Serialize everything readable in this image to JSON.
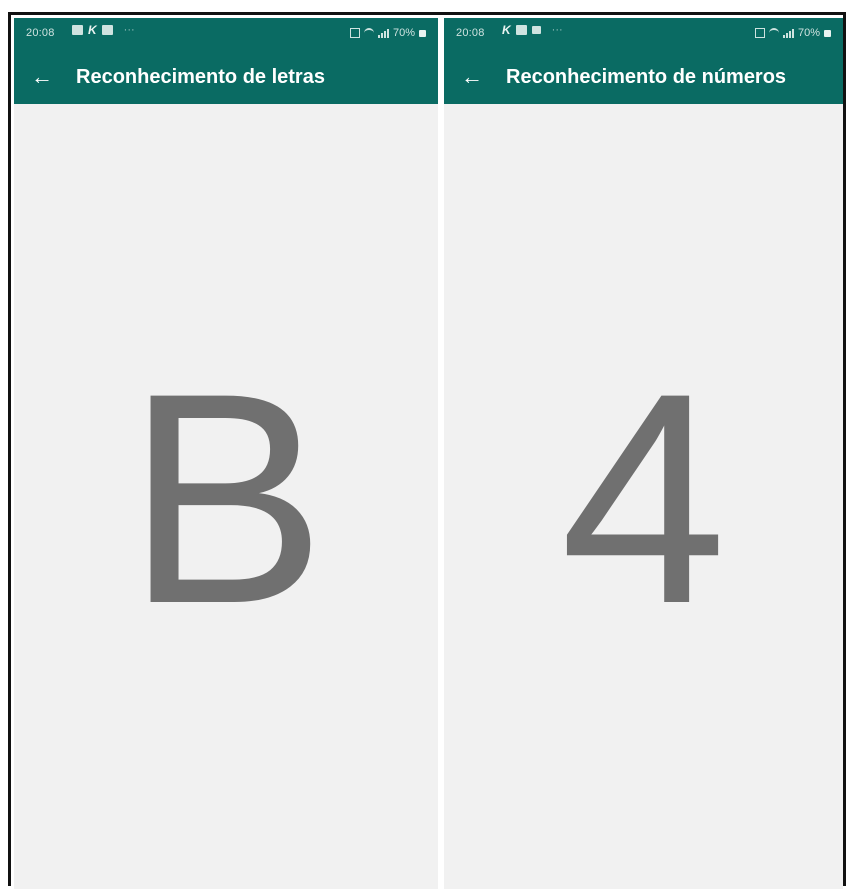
{
  "colors": {
    "app_bar": "#0a6b63",
    "background": "#f1f1f1",
    "glyph": "#707070"
  },
  "screens": [
    {
      "status": {
        "time": "20:08",
        "battery": "70%"
      },
      "title": "Reconhecimento de letras",
      "back_icon": "arrow-left-icon",
      "character": "B"
    },
    {
      "status": {
        "time": "20:08",
        "battery": "70%"
      },
      "title": "Reconhecimento de números",
      "back_icon": "arrow-left-icon",
      "character": "4"
    }
  ]
}
